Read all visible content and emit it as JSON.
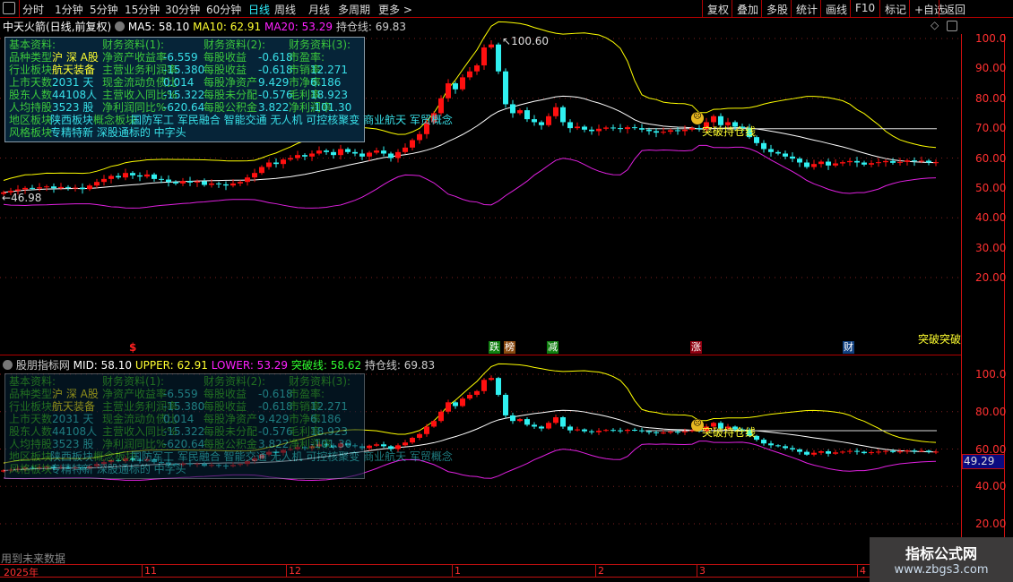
{
  "toolbar": {
    "periods": [
      "分时",
      "1分钟",
      "5分钟",
      "15分钟",
      "30分钟",
      "60分钟",
      "日线",
      "周线",
      "月线",
      "多周期",
      "更多 >"
    ],
    "active": "日线",
    "right_buttons": [
      "复权",
      "叠加",
      "多股",
      "统计",
      "画线",
      "F10",
      "标记",
      "+自选",
      "返回"
    ]
  },
  "main_header": {
    "title": "中天火箭(日线,前复权)",
    "ma5": "MA5: 58.10",
    "ma10": "MA10: 62.91",
    "ma20": "MA20: 53.29",
    "hold": "持仓线: 69.83"
  },
  "sub_header": {
    "title": "股朋指标网",
    "mid": "MID: 58.10",
    "upper": "UPPER: 62.91",
    "lower": "LOWER: 53.29",
    "break": "突破线: 58.62",
    "hold": "持仓线: 69.83"
  },
  "info": {
    "h": [
      "基本资料:",
      "财务资料(1):",
      "财务资料(2):",
      "财务资料(3):"
    ],
    "c1": [
      [
        "品种类型",
        "沪 深 A股"
      ],
      [
        "行业板块",
        "航天装备"
      ],
      [
        "上市天数",
        "2031 天"
      ],
      [
        "股东人数",
        "44108人"
      ],
      [
        "人均持股",
        "3523 股"
      ]
    ],
    "c2": [
      [
        "净资产收益率",
        "-6.559"
      ],
      [
        "主营业务利润率",
        "-15.380"
      ],
      [
        "现金流动负债比",
        "0.014"
      ],
      [
        "主营收入同比%",
        "-15.322"
      ],
      [
        "净利润同比%",
        "-620.64"
      ]
    ],
    "c3": [
      [
        "每股收益",
        "-0.618"
      ],
      [
        "每股收益",
        "-0.618"
      ],
      [
        "每股净资产",
        "9.429"
      ],
      [
        "每股未分配",
        "-0.576"
      ],
      [
        "每股公积金",
        "3.822"
      ]
    ],
    "c4": [
      [
        "市盈率:",
        ""
      ],
      [
        "市销率",
        "12.271"
      ],
      [
        "市净率",
        "6.186"
      ],
      [
        "毛利率",
        "18.923"
      ],
      [
        "净利润率",
        "-101.30"
      ]
    ],
    "region_label": "地区板块",
    "region": "陕西板块",
    "concept_label": "概念板块",
    "concept": "国防军工 军民融合 智能交通 无人机 可控核聚变 商业航天 军贸概念",
    "style_label": "风格板块",
    "style": "专精特新 深股通标的 中字头"
  },
  "annotations": {
    "high": "100.60",
    "low": "46.98",
    "break_hold": "突破持仓线",
    "break_break": "突破突破",
    "dollar": "$",
    "future": "用到未来数据",
    "cursor_price": "49.29"
  },
  "badges": [
    {
      "t": "跌",
      "c": "#108010"
    },
    {
      "t": "榜",
      "c": "#8a4a10"
    },
    {
      "t": "减",
      "c": "#108010"
    },
    {
      "t": "涨",
      "c": "#900010"
    },
    {
      "t": "财",
      "c": "#104080"
    }
  ],
  "axis_main": [
    "100.0",
    "90.00",
    "80.00",
    "70.00",
    "60.00",
    "50.00",
    "40.00",
    "30.00",
    "20.00"
  ],
  "axis_sub": [
    "100.0",
    "80.00",
    "60.00",
    "40.00",
    "20.00"
  ],
  "dates": [
    "2025年",
    "11",
    "12",
    "1",
    "2",
    "3",
    "4"
  ],
  "watermark": {
    "title": "指标公式网",
    "url": "www.zbgs3.com"
  },
  "colors": {
    "up": "#ff1010",
    "down": "#30f0f0",
    "upper": "#ffff00",
    "mid": "#ffffff",
    "lower": "#e020e0",
    "axis": "#ff3030",
    "border": "#b00000"
  },
  "chart_data": {
    "type": "candlestick",
    "hold_line": 69.83,
    "high_mark": 100.6,
    "low_mark": 46.98,
    "closes": [
      48.5,
      49,
      49.5,
      50,
      49.8,
      50.2,
      50.5,
      49.9,
      50.3,
      50,
      50.1,
      49.6,
      50.8,
      52,
      53,
      54,
      53.5,
      55,
      54.2,
      53.8,
      54.5,
      53,
      52.8,
      52,
      51.5,
      52.3,
      51.8,
      52.2,
      51,
      51.5,
      51.2,
      50.8,
      51.5,
      52,
      53.5,
      55,
      57,
      58.5,
      58,
      59.5,
      60,
      61,
      60.5,
      61.5,
      62.5,
      62,
      61,
      63,
      62,
      61.5,
      60.5,
      61.8,
      62.5,
      61.5,
      60,
      62,
      63.5,
      66,
      68,
      72,
      75,
      80,
      85,
      83,
      87,
      89,
      91,
      97,
      98,
      89,
      78,
      75,
      76,
      73,
      72,
      71,
      74,
      77,
      72,
      70,
      70.5,
      69.5,
      69,
      69.8,
      70.2,
      70,
      69.7,
      70.3,
      70,
      69.5,
      69,
      68.5,
      68.8,
      69.3,
      69,
      69.5,
      70,
      69.7,
      72,
      74,
      71,
      72,
      70.5,
      70,
      67,
      65,
      63,
      62,
      61.5,
      60.5,
      59.8,
      58.5,
      57,
      58,
      58.8,
      57.5,
      58.2,
      58.6,
      59,
      58.5,
      57.8,
      58.3,
      58.6,
      59,
      58.4,
      58.7,
      59.2,
      58.9,
      59.1,
      58.5,
      58.6
    ]
  }
}
